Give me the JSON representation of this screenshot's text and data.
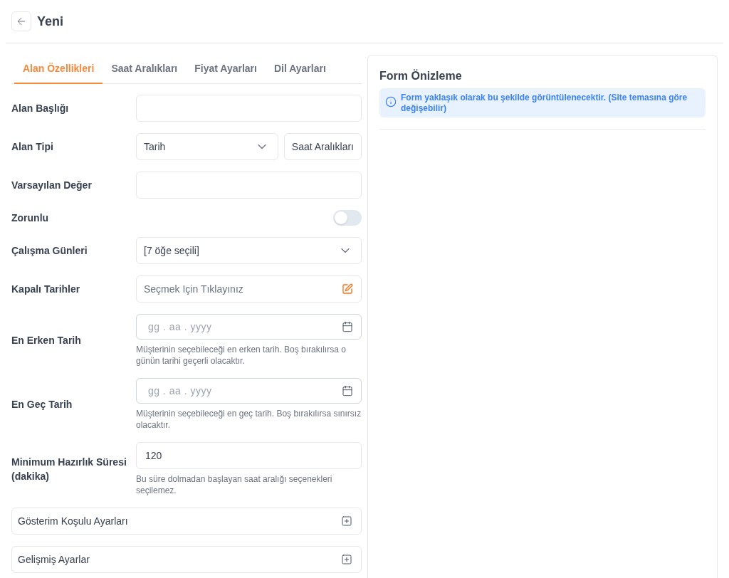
{
  "header": {
    "title": "Yeni"
  },
  "tabs": [
    {
      "label": "Alan Özellikleri",
      "selected": true
    },
    {
      "label": "Saat Aralıkları",
      "selected": false
    },
    {
      "label": "Fiyat Ayarları",
      "selected": false
    },
    {
      "label": "Dil Ayarları",
      "selected": false
    }
  ],
  "form": {
    "fields": [
      {
        "kind": "text",
        "label": "Alan Başlığı"
      },
      {
        "kind": "select_with_button",
        "label": "Alan Tipi",
        "value": "Tarih",
        "button": "Saat Aralıkları"
      },
      {
        "kind": "text",
        "label": "Varsayılan Değer"
      },
      {
        "kind": "toggle",
        "label": "Zorunlu",
        "on": false
      },
      {
        "kind": "select",
        "label": "Çalışma Günleri",
        "value": "[7 öğe seçili]"
      },
      {
        "kind": "picker",
        "label": "Kapalı Tarihler",
        "placeholder": "Seçmek Için Tıklayınız"
      },
      {
        "kind": "date",
        "label": "En Erken Tarih",
        "placeholder": "gg . aa . yyyy",
        "help": "Müşterinin seçebileceği en erken tarih. Boş bırakılırsa o günün tarihi geçerli olacaktır."
      },
      {
        "kind": "date",
        "label": "En Geç Tarih",
        "placeholder": "gg . aa . yyyy",
        "help": "Müşterinin seçebileceği en geç tarih. Boş bırakılırsa sınırsız olacaktır."
      },
      {
        "kind": "text",
        "label": "Minimum Hazırlık Süresi (dakika)",
        "value": "120",
        "help": "Bu süre dolmadan başlayan saat aralığı seçenekleri seçilemez."
      }
    ]
  },
  "sections": [
    {
      "label": "Gösterim Koşulu Ayarları",
      "expanded": false
    },
    {
      "label": "Gelişmiş Ayarlar",
      "expanded": false
    }
  ],
  "preview": {
    "title": "Form Önizleme",
    "notice": "Form yaklaşık olarak bu şekilde görüntülenecektir. (Site temasına göre değişebilir)"
  }
}
